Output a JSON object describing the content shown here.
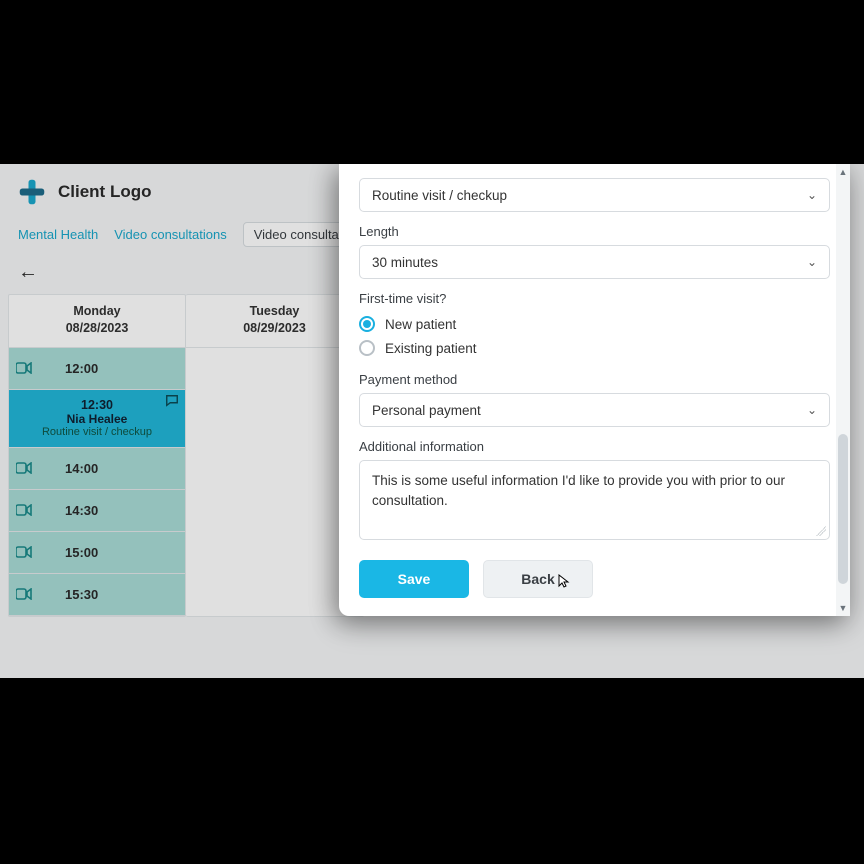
{
  "header": {
    "client_name": "Client Logo"
  },
  "tabs": {
    "link1": "Mental Health",
    "link2": "Video consultations",
    "chip": "Video consultatio"
  },
  "calendar": {
    "col0": {
      "dow": "Monday",
      "date": "08/28/2023"
    },
    "col1": {
      "dow": "Tuesday",
      "date": "08/29/2023"
    },
    "slots": {
      "s0": "12:00",
      "s1_time": "12:30",
      "s1_name": "Nia Healee",
      "s1_reason": "Routine visit / checkup",
      "s2": "14:00",
      "s3": "14:30",
      "s4": "15:00",
      "s5": "15:30"
    }
  },
  "modal": {
    "visit_type_value": "Routine visit / checkup",
    "length_label": "Length",
    "length_value": "30 minutes",
    "first_time_label": "First-time visit?",
    "radio_new": "New patient",
    "radio_existing": "Existing patient",
    "payment_label": "Payment method",
    "payment_value": "Personal payment",
    "addl_label": "Additional information",
    "addl_value": "This is some useful information I'd like to provide you with prior to our consultation.",
    "save": "Save",
    "back": "Back"
  }
}
